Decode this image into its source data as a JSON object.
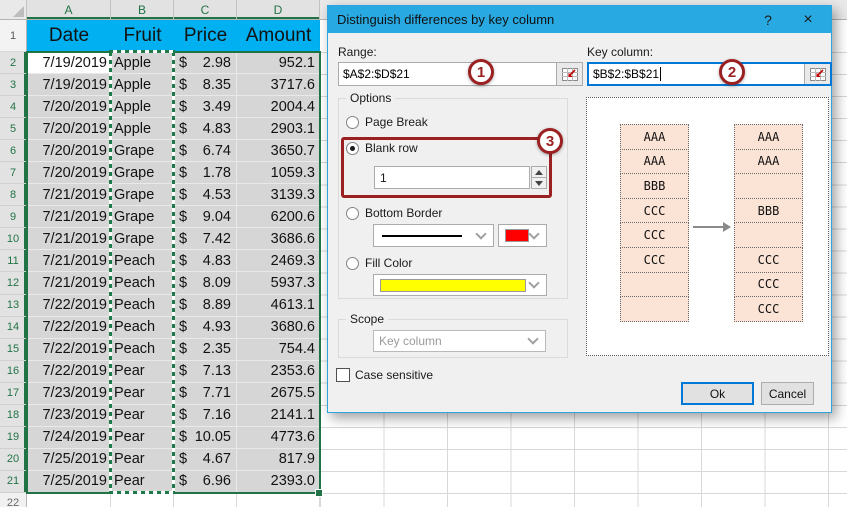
{
  "spreadsheet": {
    "column_headers": [
      "A",
      "B",
      "C",
      "D"
    ],
    "row1": {
      "number": "1",
      "headers": [
        "Date",
        "Fruit",
        "Price",
        "Amount"
      ]
    },
    "currency_symbol": "$",
    "next_row_number": "22",
    "rows": [
      {
        "n": "2",
        "date": "7/19/2019",
        "fruit": "Apple",
        "price": "2.98",
        "amount": "952.1"
      },
      {
        "n": "3",
        "date": "7/19/2019",
        "fruit": "Apple",
        "price": "8.35",
        "amount": "3717.6"
      },
      {
        "n": "4",
        "date": "7/20/2019",
        "fruit": "Apple",
        "price": "3.49",
        "amount": "2004.4"
      },
      {
        "n": "5",
        "date": "7/20/2019",
        "fruit": "Apple",
        "price": "4.83",
        "amount": "2903.1"
      },
      {
        "n": "6",
        "date": "7/20/2019",
        "fruit": "Grape",
        "price": "6.74",
        "amount": "3650.7"
      },
      {
        "n": "7",
        "date": "7/20/2019",
        "fruit": "Grape",
        "price": "1.78",
        "amount": "1059.3"
      },
      {
        "n": "8",
        "date": "7/21/2019",
        "fruit": "Grape",
        "price": "4.53",
        "amount": "3139.3"
      },
      {
        "n": "9",
        "date": "7/21/2019",
        "fruit": "Grape",
        "price": "9.04",
        "amount": "6200.6"
      },
      {
        "n": "10",
        "date": "7/21/2019",
        "fruit": "Grape",
        "price": "7.42",
        "amount": "3686.6"
      },
      {
        "n": "11",
        "date": "7/21/2019",
        "fruit": "Peach",
        "price": "4.83",
        "amount": "2469.3"
      },
      {
        "n": "12",
        "date": "7/21/2019",
        "fruit": "Peach",
        "price": "8.09",
        "amount": "5937.3"
      },
      {
        "n": "13",
        "date": "7/22/2019",
        "fruit": "Peach",
        "price": "8.89",
        "amount": "4613.1"
      },
      {
        "n": "14",
        "date": "7/22/2019",
        "fruit": "Peach",
        "price": "4.93",
        "amount": "3680.6"
      },
      {
        "n": "15",
        "date": "7/22/2019",
        "fruit": "Peach",
        "price": "2.35",
        "amount": "754.4"
      },
      {
        "n": "16",
        "date": "7/22/2019",
        "fruit": "Pear",
        "price": "7.13",
        "amount": "2353.6"
      },
      {
        "n": "17",
        "date": "7/23/2019",
        "fruit": "Pear",
        "price": "7.71",
        "amount": "2675.5"
      },
      {
        "n": "18",
        "date": "7/23/2019",
        "fruit": "Pear",
        "price": "7.16",
        "amount": "2141.1"
      },
      {
        "n": "19",
        "date": "7/24/2019",
        "fruit": "Pear",
        "price": "10.05",
        "amount": "4773.6"
      },
      {
        "n": "20",
        "date": "7/25/2019",
        "fruit": "Pear",
        "price": "4.67",
        "amount": "817.9"
      },
      {
        "n": "21",
        "date": "7/25/2019",
        "fruit": "Pear",
        "price": "6.96",
        "amount": "2393.0"
      }
    ],
    "selection_color": "#217346",
    "header_fill_color": "#00B0F0"
  },
  "dialog": {
    "title": "Distinguish differences by key column",
    "help_label": "?",
    "close_label": "×",
    "range_label": "Range:",
    "range_value": "$A$2:$D$21",
    "key_label": "Key column:",
    "key_value": "$B$2:$B$21",
    "badge_1": "1",
    "badge_2": "2",
    "badge_3": "3",
    "options_caption": "Options",
    "opt_page_break": "Page Break",
    "opt_blank_row": "Blank row",
    "blank_row_value": "1",
    "opt_bottom_border": "Bottom Border",
    "opt_fill_color": "Fill Color",
    "border_color": "#FF0000",
    "fill_color_value": "#FFFF00",
    "scope_caption": "Scope",
    "scope_value": "Key column",
    "case_sensitive_label": "Case sensitive",
    "ok_label": "Ok",
    "cancel_label": "Cancel",
    "accent_color": "#29A9E1",
    "annotation_color": "#9B2022",
    "preview_before": [
      "AAA",
      "AAA",
      "BBB",
      "CCC",
      "CCC",
      "CCC",
      "",
      ""
    ],
    "preview_after": [
      "AAA",
      "AAA",
      "",
      "BBB",
      "",
      "CCC",
      "CCC",
      "CCC"
    ]
  }
}
